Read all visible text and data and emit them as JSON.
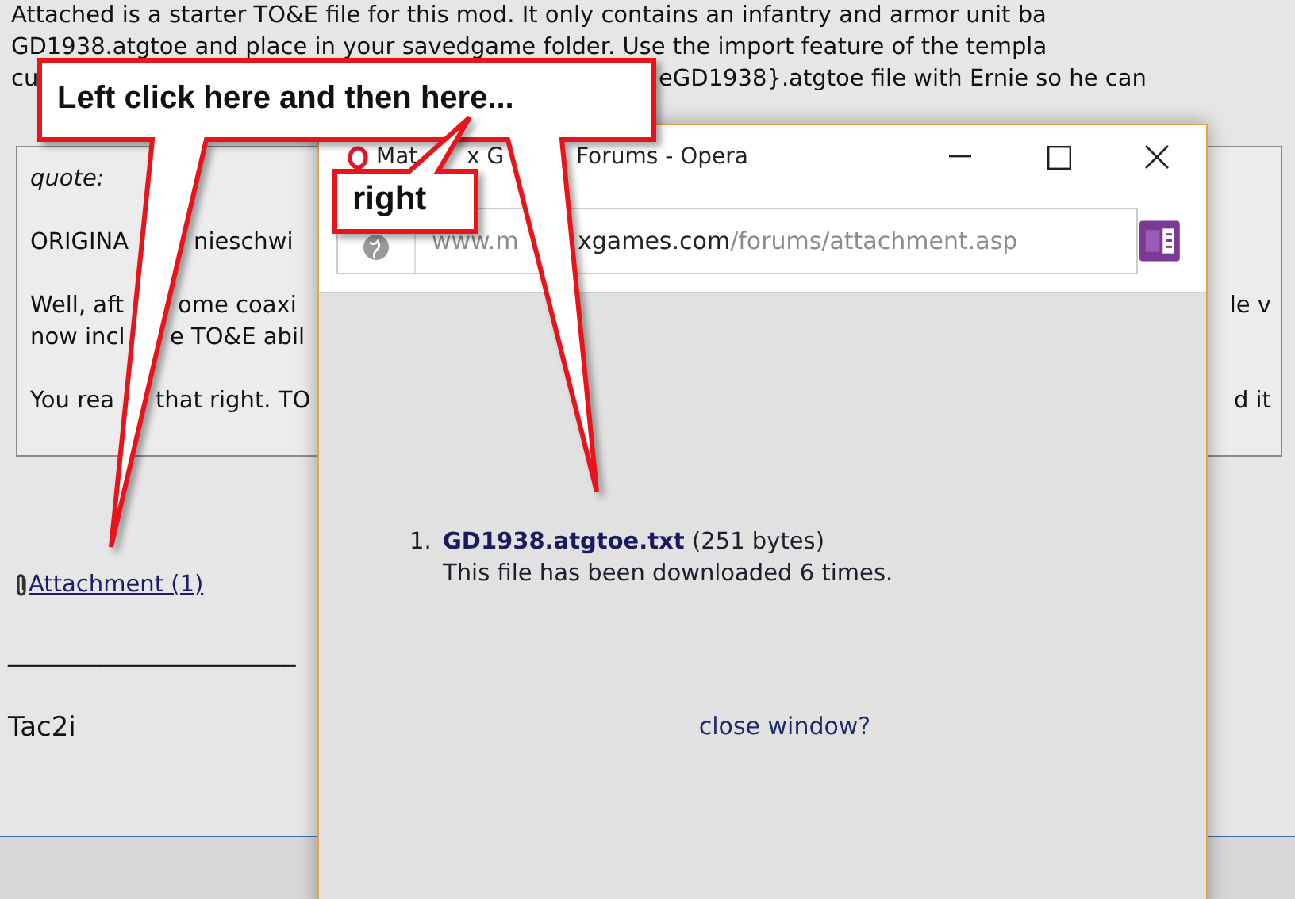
{
  "post": {
    "lines": [
      [
        "Attached is a starter TO&E file for this mod. It only contains an infantry and armor unit ba"
      ],
      [
        "GD1938.atgtoe and place in your savedgame folder. Use the import feature of the templa"
      ],
      [
        "cu",
        "eGD1938}.atgtoe file with Ernie so he can"
      ]
    ]
  },
  "quote": {
    "label": "quote:",
    "paragraphs": [
      {
        "lines": [
          {
            "left": [
              "ORIGINA",
              "nieschwi"
            ]
          }
        ]
      },
      {
        "lines": [
          {
            "left": [
              "Well, aft",
              "ome coaxi"
            ],
            "right": "le v"
          },
          {
            "left": [
              "now incl",
              "e TO&E abil"
            ]
          }
        ]
      },
      {
        "lines": [
          {
            "left": [
              "You rea",
              "that right. TO"
            ],
            "right": "d it"
          }
        ]
      }
    ]
  },
  "attachment": {
    "label": "Attachment (1)"
  },
  "separator": "_________________________",
  "signature": "Tac2i",
  "popup": {
    "title": [
      "Mat",
      "x G",
      "Forums - Opera"
    ],
    "url": {
      "head": "www.m",
      "host": "xgames.com",
      "path": "/forums/attachment.asp"
    },
    "files": [
      {
        "number": "1.",
        "name": "GD1938.atgtoe.txt",
        "size": "(251 bytes)",
        "note": "This file has been downloaded 6 times."
      }
    ],
    "close_link": "close window?"
  },
  "callouts": [
    {
      "kind": "main",
      "text": "Left click here and then here..."
    },
    {
      "kind": "small",
      "text": "right"
    }
  ]
}
